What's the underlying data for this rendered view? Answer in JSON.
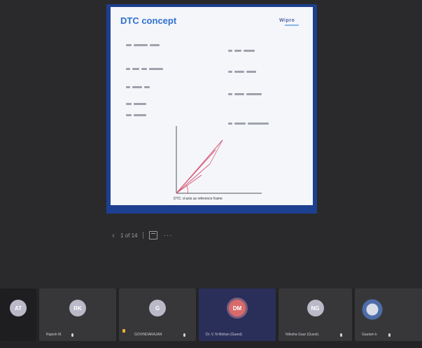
{
  "slide": {
    "title": "DTC concept",
    "logo": "Wipro",
    "caption": "DTC: d-axis as reference frame"
  },
  "toolbar": {
    "page_indicator": "1 of 14",
    "prev_icon": "chevron-left-icon",
    "present_icon": "present-icon",
    "more_icon": "more-horizontal-icon"
  },
  "participants": [
    {
      "initials": "AT",
      "name": ""
    },
    {
      "initials": "RK",
      "name": "Rajesh M."
    },
    {
      "initials": "G",
      "name": "GOVINDARAJAN"
    },
    {
      "initials": "DM",
      "name": "Dr. V. N Mohan (Guest)"
    },
    {
      "initials": "NG",
      "name": "Nilesha Gaur (Guest)"
    },
    {
      "initials": "",
      "name": "Gautam k"
    }
  ]
}
